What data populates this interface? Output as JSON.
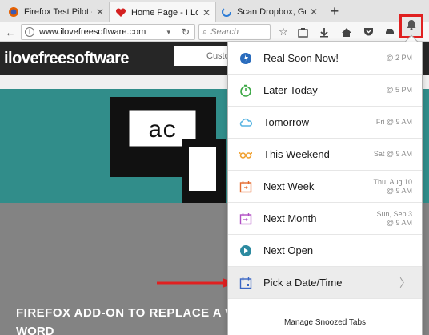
{
  "tabs": [
    {
      "title": "Firefox Test Pilot - Sn",
      "icon": "firefox-icon"
    },
    {
      "title": "Home Page - I Love F",
      "icon": "heart-icon"
    },
    {
      "title": "Scan Dropbox, Googl",
      "icon": "spinner-icon"
    }
  ],
  "newtab_label": "+",
  "url": "www.ilovefreesoftware.com",
  "search_placeholder": "Search",
  "site": {
    "logo_a": "ilove",
    "logo_b": "free",
    "logo_c": "software",
    "search_text": "Custo",
    "hero_letters": "ac",
    "article_title": "FIREFOX ADD-ON TO REPLACE A WORD O",
    "article_title_2": "WORD"
  },
  "snooze_menu": {
    "items": [
      {
        "label": "Real Soon Now!",
        "when_1": "@ 2 PM",
        "when_2": "",
        "icon": "clock-lightning-icon",
        "color": "#2a6cbd"
      },
      {
        "label": "Later Today",
        "when_1": "@ 5 PM",
        "when_2": "",
        "icon": "stopwatch-icon",
        "color": "#3ca845"
      },
      {
        "label": "Tomorrow",
        "when_1": "Fri @ 9 AM",
        "when_2": "",
        "icon": "cloud-sun-icon",
        "color": "#58b4e2"
      },
      {
        "label": "This Weekend",
        "when_1": "Sat @ 9 AM",
        "when_2": "",
        "icon": "sunglasses-icon",
        "color": "#f0a030"
      },
      {
        "label": "Next Week",
        "when_1": "Thu, Aug 10",
        "when_2": "@ 9 AM",
        "icon": "calendar-next-week-icon",
        "color": "#e36a2e"
      },
      {
        "label": "Next Month",
        "when_1": "Sun, Sep 3",
        "when_2": "@ 9 AM",
        "icon": "calendar-next-month-icon",
        "color": "#b04ec3"
      },
      {
        "label": "Next Open",
        "when_1": "",
        "when_2": "",
        "icon": "next-open-icon",
        "color": "#2c8aa0"
      },
      {
        "label": "Pick a Date/Time",
        "when_1": "",
        "when_2": "",
        "icon": "calendar-pick-icon",
        "color": "#3a66c4"
      }
    ],
    "chevron": "〉",
    "manage_label": "Manage Snoozed Tabs"
  },
  "colors": {
    "highlight_box": "#e02020",
    "teal_band": "#318d8a",
    "arrow": "#e02020"
  }
}
